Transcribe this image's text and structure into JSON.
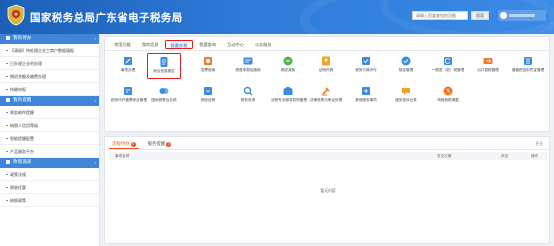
{
  "header": {
    "title": "国家税务总局广东省电子税务局",
    "search_placeholder": "请输入您要查找的功能",
    "search_button": "搜索"
  },
  "sidebar": {
    "sections": [
      {
        "title": "我的待办",
        "items": [
          "【清册】待处理企业工商户数据填报",
          "已办理企业的办理",
          "期初余额及缴费办理",
          "待缴申报"
        ]
      },
      {
        "title": "我的提醒",
        "items": [
          "税务邮件提醒",
          "纳税人信用等级",
          "智能提醒配置",
          "产品服务平台"
        ]
      },
      {
        "title": "政策速递",
        "items": [
          "政策法规",
          "税收优惠",
          "纳税政策"
        ]
      }
    ]
  },
  "main": {
    "tabs": [
      "常用功能",
      "我的信息",
      "我要办税",
      "我要查询",
      "互动中心",
      "公众服务"
    ],
    "active_tab_index": 2,
    "functions": [
      {
        "label": "事项办理",
        "icon": "edit-icon",
        "color": "#3c8dde"
      },
      {
        "label": "综合信息报告",
        "icon": "document-icon",
        "color": "#3c8dde",
        "highlighted": true
      },
      {
        "label": "发票使用",
        "icon": "invoice-icon",
        "color": "#f07a2a"
      },
      {
        "label": "税费申报及缴纳",
        "icon": "tax-declare-icon",
        "color": "#3c8dde"
      },
      {
        "label": "税收减免",
        "icon": "reduction-icon",
        "color": "#52b44a"
      },
      {
        "label": "证明开具",
        "icon": "certificate-icon",
        "color": "#f0a22a"
      },
      {
        "label": "税务行政许可",
        "icon": "permit-icon",
        "color": "#3c8dde"
      },
      {
        "label": "核定管理",
        "icon": "verify-icon",
        "color": "#3c8dde"
      },
      {
        "label": "一般退（抵）税管理",
        "icon": "refund-icon",
        "color": "#3c8dde"
      },
      {
        "label": "出口退税管理",
        "icon": "export-refund-icon",
        "color": "#f07a2a"
      },
      {
        "label": "增值税抵扣凭证管理",
        "icon": "deduction-icon",
        "color": "#3c8dde"
      },
      {
        "label": "税务代开普票综合管理",
        "icon": "agent-invoice-icon",
        "color": "#3c8dde"
      },
      {
        "label": "国地税联合办税",
        "icon": "joint-office-icon",
        "color": "#3c8dde"
      },
      {
        "label": "税收证明",
        "icon": "proof-icon",
        "color": "#3c8dde"
      },
      {
        "label": "税务查询",
        "icon": "search-doc-icon",
        "color": "#3c8dde"
      },
      {
        "label": "涉税专业服务机构管理",
        "icon": "agency-icon",
        "color": "#3c8dde"
      },
      {
        "label": "法律追责与争议处理",
        "icon": "law-icon",
        "color": "#f07a2a"
      },
      {
        "label": "其他服务事项",
        "icon": "service-icon",
        "color": "#3c8dde"
      },
      {
        "label": "服务投诉记录",
        "icon": "complaint-icon",
        "color": "#f0a22a"
      },
      {
        "label": "特别纳税调整",
        "icon": "adjust-icon",
        "color": "#f07a2a"
      }
    ],
    "bottom": {
      "tabs": [
        {
          "label": "流程待办",
          "badge": "0"
        },
        {
          "label": "服务提醒",
          "badge": "0"
        }
      ],
      "more": "更多",
      "columns": [
        "事项名称",
        "发文日期",
        "状态",
        "操作"
      ],
      "empty_text": "暂无内容"
    }
  },
  "colors": {
    "header_blue": "#1b5fb8",
    "sidebar_section": "#3f86d8",
    "highlight_red": "#e02020",
    "active_orange": "#e0561b"
  }
}
